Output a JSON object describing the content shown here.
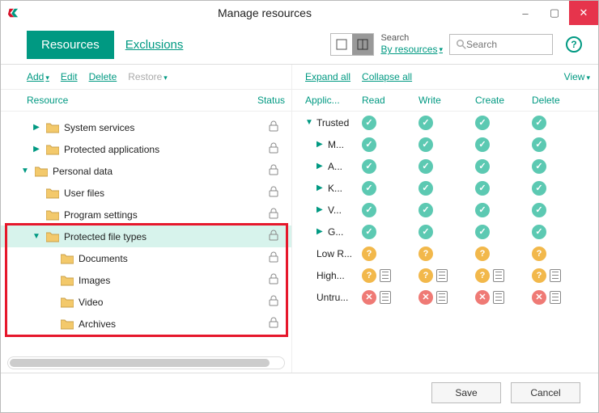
{
  "window": {
    "title": "Manage resources"
  },
  "tabs": {
    "resources": "Resources",
    "exclusions": "Exclusions"
  },
  "search": {
    "label": "Search",
    "by": "By resources",
    "placeholder": "Search"
  },
  "left": {
    "actions": {
      "add": "Add",
      "edit": "Edit",
      "delete": "Delete",
      "restore": "Restore"
    },
    "head": {
      "resource": "Resource",
      "status": "Status"
    },
    "rows": [
      {
        "label": "System services",
        "indent": 1,
        "tri": "right",
        "sel": false
      },
      {
        "label": "Protected applications",
        "indent": 1,
        "tri": "right",
        "sel": false
      },
      {
        "label": "Personal data",
        "indent": 0,
        "tri": "down",
        "sel": false
      },
      {
        "label": "User files",
        "indent": 1,
        "tri": "",
        "sel": false
      },
      {
        "label": "Program settings",
        "indent": 1,
        "tri": "",
        "sel": false
      },
      {
        "label": "Protected file types",
        "indent": 1,
        "tri": "down",
        "sel": true
      },
      {
        "label": "Documents",
        "indent": 2,
        "tri": "",
        "sel": false
      },
      {
        "label": "Images",
        "indent": 2,
        "tri": "",
        "sel": false
      },
      {
        "label": "Video",
        "indent": 2,
        "tri": "",
        "sel": false
      },
      {
        "label": "Archives",
        "indent": 2,
        "tri": "",
        "sel": false
      }
    ]
  },
  "right": {
    "actions": {
      "expand": "Expand all",
      "collapse": "Collapse all",
      "view": "View"
    },
    "head": {
      "app": "Applic...",
      "read": "Read",
      "write": "Write",
      "create": "Create",
      "delete": "Delete"
    },
    "rows": [
      {
        "label": "Trusted",
        "indent": 0,
        "tri": "down",
        "perm": "allow",
        "log": false
      },
      {
        "label": "M...",
        "indent": 1,
        "tri": "right",
        "perm": "allow",
        "log": false
      },
      {
        "label": "A...",
        "indent": 1,
        "tri": "right",
        "perm": "allow",
        "log": false
      },
      {
        "label": "K...",
        "indent": 1,
        "tri": "right",
        "perm": "allow",
        "log": false
      },
      {
        "label": "V...",
        "indent": 1,
        "tri": "right",
        "perm": "allow",
        "log": false
      },
      {
        "label": "G...",
        "indent": 1,
        "tri": "right",
        "perm": "allow",
        "log": false
      },
      {
        "label": "Low R...",
        "indent": 0,
        "tri": "",
        "perm": "ask",
        "log": false
      },
      {
        "label": "High...",
        "indent": 0,
        "tri": "",
        "perm": "ask",
        "log": true
      },
      {
        "label": "Untru...",
        "indent": 0,
        "tri": "",
        "perm": "deny",
        "log": true
      }
    ]
  },
  "footer": {
    "save": "Save",
    "cancel": "Cancel"
  }
}
